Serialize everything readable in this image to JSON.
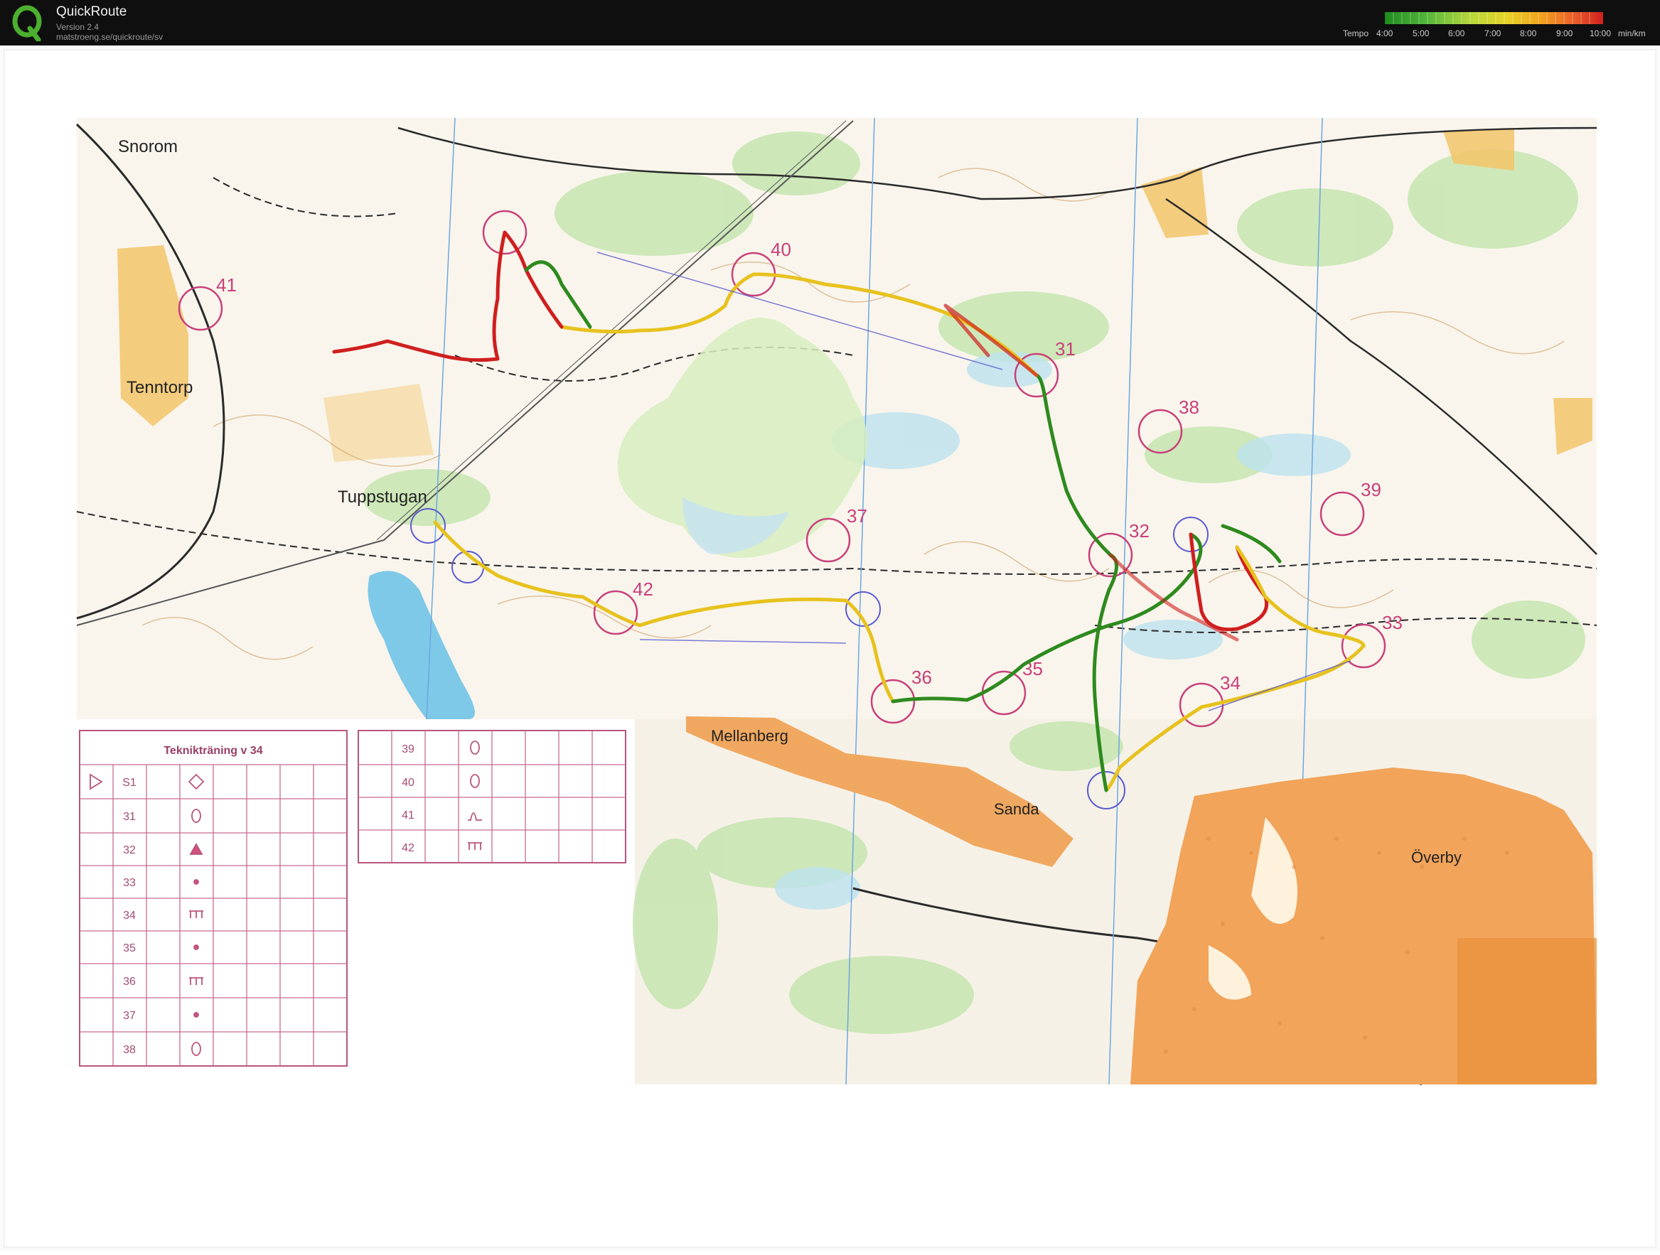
{
  "app": {
    "title": "QuickRoute",
    "version": "Version 2.4",
    "url": "matstroeng.se/quickroute/sv"
  },
  "legend": {
    "label": "Tempo",
    "ticks": [
      "4:00",
      "5:00",
      "6:00",
      "7:00",
      "8:00",
      "9:00",
      "10:00"
    ],
    "unit": "min/km",
    "colors": [
      "#1f8a1f",
      "#4fb43a",
      "#b9d93b",
      "#e7d226",
      "#f3a11f",
      "#e8582a",
      "#cf1f1f"
    ]
  },
  "map": {
    "place_names": [
      "Snorom",
      "Tenntorp",
      "Tuppstugan",
      "Mellanberg",
      "Sanda",
      "Överby"
    ],
    "control_numbers": [
      "31",
      "32",
      "33",
      "34",
      "35",
      "36",
      "37",
      "38",
      "39",
      "40",
      "41",
      "42"
    ],
    "course_color": "#c8407a",
    "route_colors": {
      "slow": "#cf1f1f",
      "medium": "#e7c21e",
      "fast": "#2e8a1e"
    }
  },
  "control_table": {
    "title": "Teknikträning v 34",
    "left_rows": [
      {
        "code": "S1",
        "symbol": "diamond-icon",
        "start": true
      },
      {
        "code": "31",
        "symbol": "ellipse-icon"
      },
      {
        "code": "32",
        "symbol": "triangle-icon"
      },
      {
        "code": "33",
        "symbol": "dot-icon"
      },
      {
        "code": "34",
        "symbol": "comb-icon"
      },
      {
        "code": "35",
        "symbol": "dot-icon"
      },
      {
        "code": "36",
        "symbol": "comb-icon"
      },
      {
        "code": "37",
        "symbol": "dot-icon"
      },
      {
        "code": "38",
        "symbol": "ellipse-icon"
      }
    ],
    "right_rows": [
      {
        "code": "39",
        "symbol": "ellipse-icon"
      },
      {
        "code": "40",
        "symbol": "ellipse-icon"
      },
      {
        "code": "41",
        "symbol": "hill-icon"
      },
      {
        "code": "42",
        "symbol": "comb-icon"
      }
    ]
  }
}
